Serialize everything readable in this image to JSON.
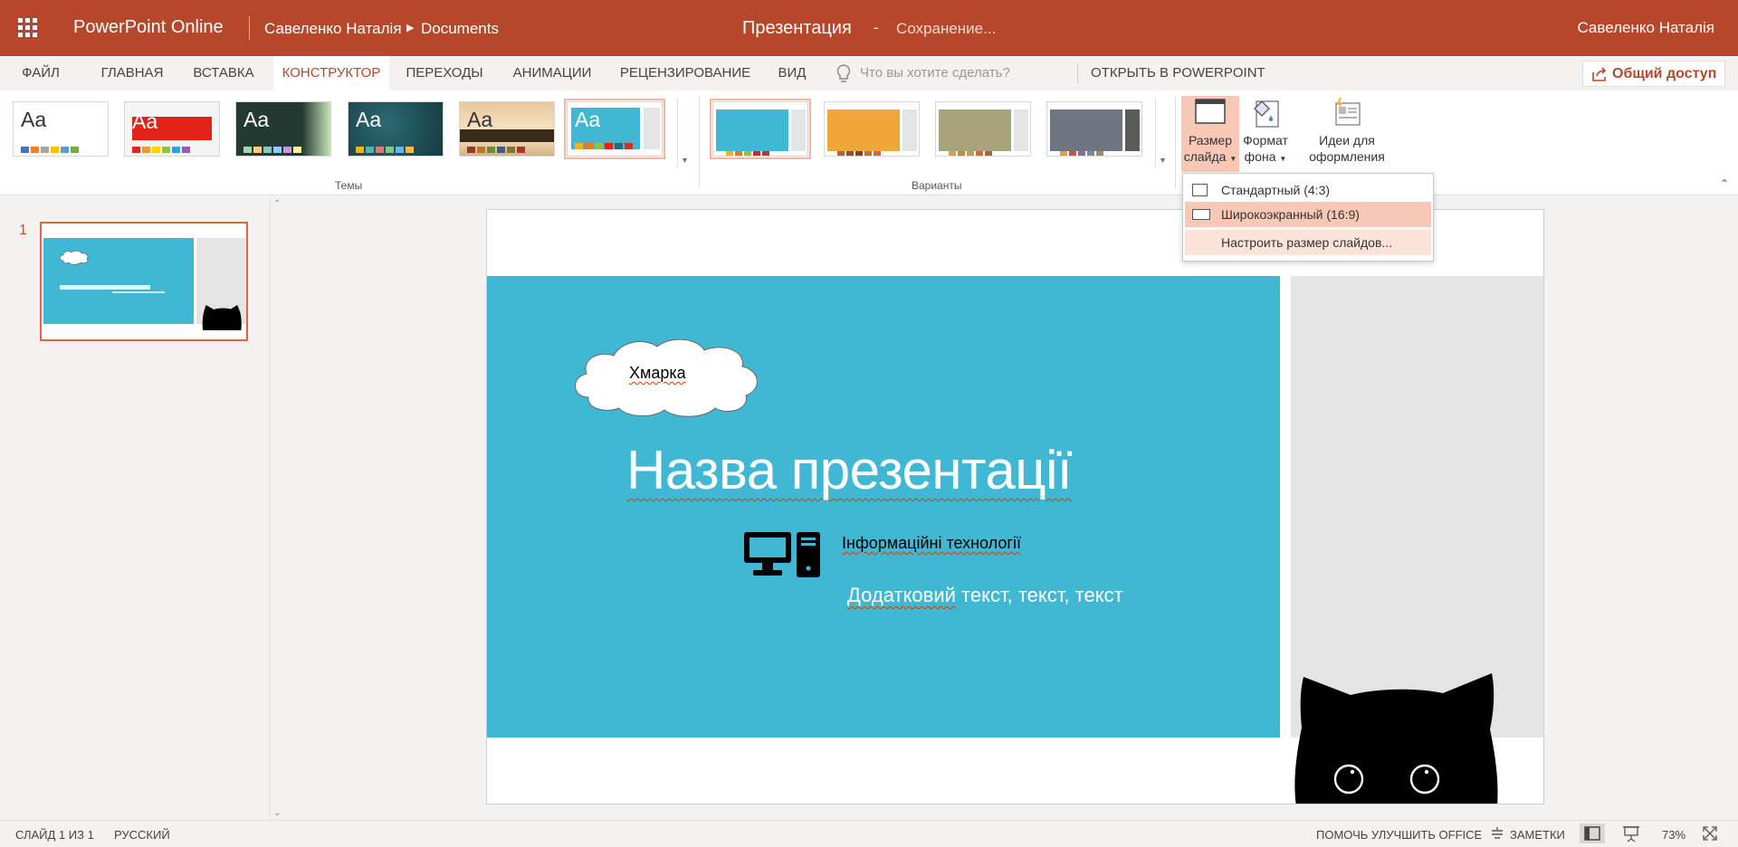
{
  "titlebar": {
    "app_name": "PowerPoint Online",
    "breadcrumb_user": "Савеленко Наталія",
    "breadcrumb_folder": "Documents",
    "doc_title": "Презентация",
    "dash": "-",
    "save_status": "Сохранение...",
    "user_name": "Савеленко Наталія",
    "color": "#b7472a"
  },
  "tabs": [
    {
      "label": "ФАЙЛ"
    },
    {
      "label": "ГЛАВНАЯ"
    },
    {
      "label": "ВСТАВКА"
    },
    {
      "label": "КОНСТРУКТОР",
      "active": true
    },
    {
      "label": "ПЕРЕХОДЫ"
    },
    {
      "label": "АНИМАЦИИ"
    },
    {
      "label": "РЕЦЕНЗИРОВАНИЕ"
    },
    {
      "label": "ВИД"
    }
  ],
  "tell_me_placeholder": "Что вы хотите сделать?",
  "open_in_app": "ОТКРЫТЬ В POWERPOINT",
  "share_label": "Общий доступ",
  "ribbon": {
    "themes_label": "Темы",
    "variants_label": "Варианты",
    "theme_preview_text": "Aa",
    "slide_size": {
      "line1": "Размер",
      "line2": "слайда"
    },
    "bg_format": {
      "line1": "Формат",
      "line2": "фона"
    },
    "design_ideas": {
      "line1": "Идеи для",
      "line2": "оформления"
    }
  },
  "slide_size_menu": [
    {
      "label": "Стандартный (4:3)"
    },
    {
      "label": "Широкоэкранный (16:9)",
      "selected": true
    },
    {
      "label": "Настроить размер слайдов..."
    }
  ],
  "thumbnails": [
    {
      "number": "1"
    }
  ],
  "slide": {
    "cloud_text": "Хмарка",
    "title": "Назва презентації",
    "subtitle": "Інформаційні технології",
    "extra_word": "Додатковий",
    "extra_rest": " текст, текст, текст",
    "main_color": "#41b8d3",
    "side_color": "#e4e4e4"
  },
  "statusbar": {
    "slide_info": "СЛАЙД 1 ИЗ 1",
    "language": "РУССКИЙ",
    "help": "ПОМОЧЬ УЛУЧШИТЬ OFFICE",
    "notes": "ЗАМЕТКИ",
    "zoom": "73%"
  }
}
